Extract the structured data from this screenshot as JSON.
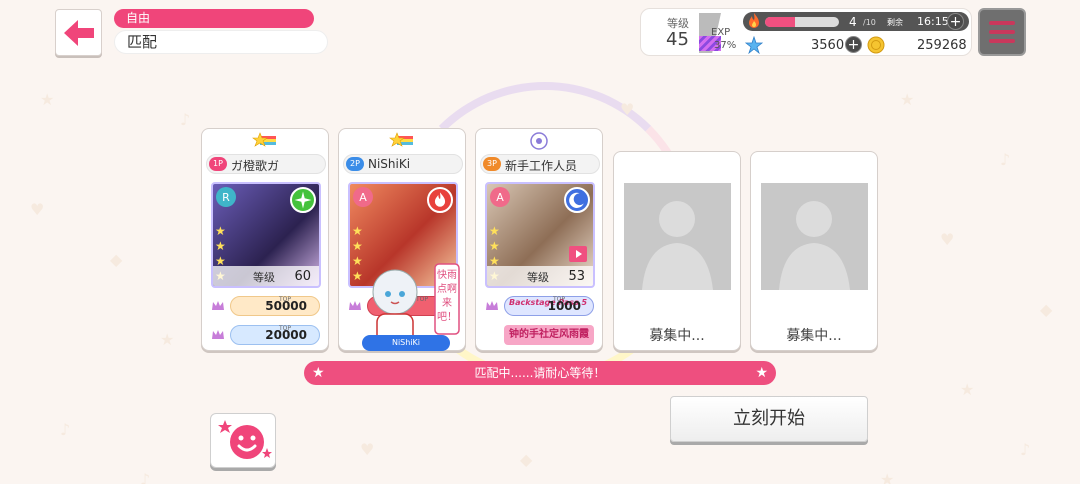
{
  "header": {
    "mode_tag": "自由",
    "mode_title": "匹配"
  },
  "status": {
    "level_label": "等级",
    "level": "45",
    "exp_label": "EXP",
    "exp_percent": "37%",
    "exp_fill_fraction": 0.37,
    "stamina_current": "4",
    "stamina_max": "/10",
    "stamina_fill_fraction": 0.4,
    "remain_label": "剩余",
    "remain_time": "16:15",
    "star_gems": "3560",
    "coins": "259268",
    "plus": "+"
  },
  "players": [
    {
      "slot": "1P",
      "slot_color": "#f0457a",
      "name": "ガ橙歌ガ",
      "badge": "rainbow-star-badge",
      "level_label": "等级",
      "level": "60",
      "attribute": "pure",
      "score_top_label": "TOP",
      "score": "50000",
      "score2": "20000"
    },
    {
      "slot": "2P",
      "slot_color": "#3b8de8",
      "name": "NiShiKi",
      "badge": "rainbow-star-badge",
      "level_label": "",
      "level": "",
      "attribute": "powerful",
      "score_top_label": "TOP",
      "sticker_text": "快雨点啊来吧！",
      "sticker_name": "NiShiKi"
    },
    {
      "slot": "3P",
      "slot_color": "#f08a2a",
      "name": "新手工作人员",
      "badge": "flower-badge",
      "level_label": "等级",
      "level": "53",
      "attribute": "cool",
      "score_top_label": "TOP",
      "score": "1000",
      "title_text": "Backstage Pass 5",
      "title2_text": "钟的手社定风雨霞"
    }
  ],
  "empty_slots": [
    {
      "label": "募集中..."
    },
    {
      "label": "募集中..."
    }
  ],
  "progress_text": "匹配中......请耐心等待！",
  "start_button": "立刻开始",
  "colors": {
    "accent": "#f0457a",
    "banner": "#ee4f7f",
    "menu_bars": "#c9385c"
  }
}
